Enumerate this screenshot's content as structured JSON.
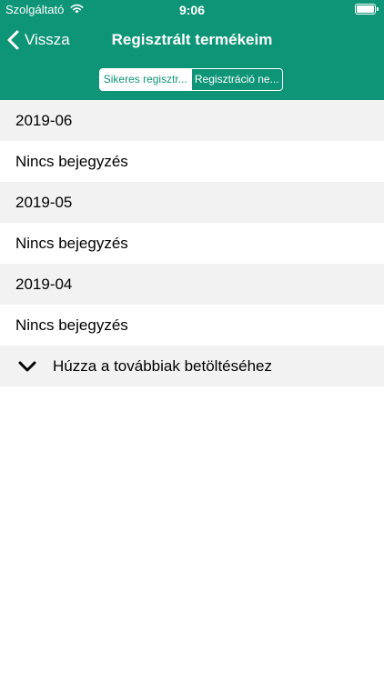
{
  "status_bar": {
    "carrier": "Szolgáltató",
    "time": "9:06",
    "icons": [
      "wifi-icon",
      "battery-icon"
    ]
  },
  "nav": {
    "back_label": "Vissza",
    "title": "Regisztrált termékeim",
    "back_icon": "chevron-left-icon"
  },
  "segments": [
    {
      "label": "Sikeres regisztr...",
      "selected": true
    },
    {
      "label": "Regisztráció ne...",
      "selected": false
    }
  ],
  "list": {
    "sections": [
      {
        "header": "2019-06",
        "empty_label": "Nincs bejegyzés"
      },
      {
        "header": "2019-05",
        "empty_label": "Nincs bejegyzés"
      },
      {
        "header": "2019-04",
        "empty_label": "Nincs bejegyzés"
      }
    ],
    "load_more_label": "Húzza a továbbiak betöltéséhez",
    "load_more_icon": "chevron-down-icon"
  },
  "colors": {
    "accent": "#0e9577",
    "section_background": "#f2f2f2",
    "text": "#000000"
  }
}
